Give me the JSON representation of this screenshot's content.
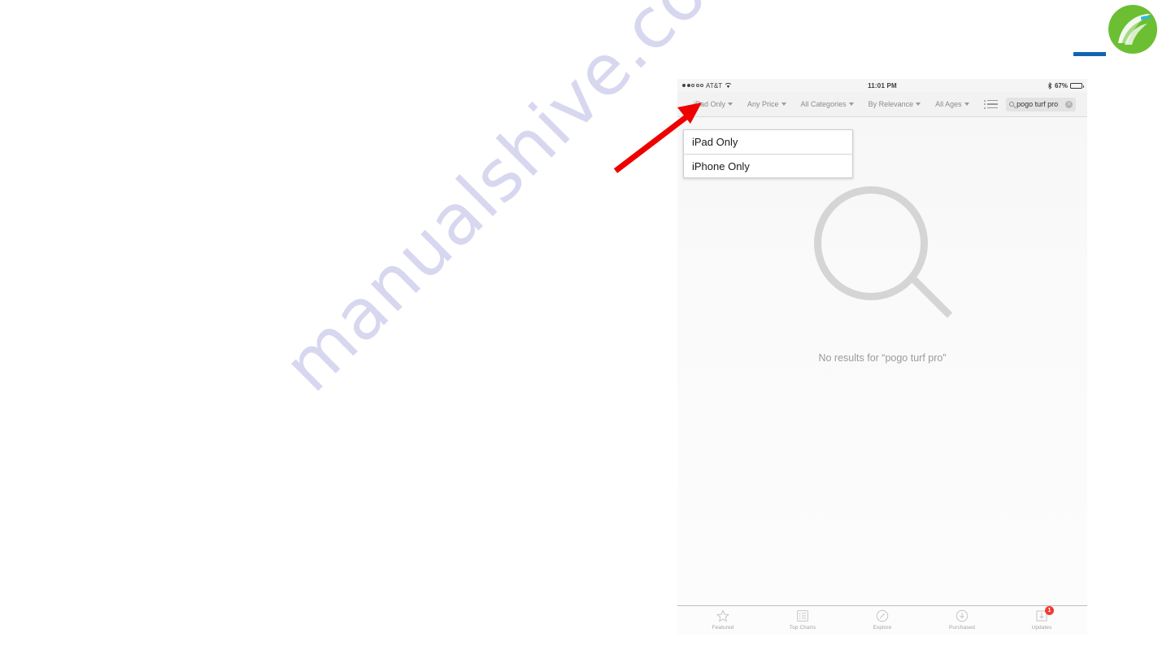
{
  "page": {
    "watermark": "manualshive.com",
    "brand_accent": "#6cbe33",
    "rule_color": "#1264b0"
  },
  "annotation": {
    "arrow_color": "#ee0000",
    "arrow_name": "red-callout-arrow",
    "points_to": "iPad Only"
  },
  "device": {
    "status_bar": {
      "signal_dots_filled": 2,
      "signal_dots_total": 5,
      "carrier": "AT&T",
      "wifi": "wifi-icon",
      "time": "11:01 PM",
      "bluetooth": "bluetooth-icon",
      "battery_percent": "67%",
      "battery_level": 67
    },
    "filter_bar": {
      "filters": [
        {
          "label": "iPad Only",
          "name": "device-filter"
        },
        {
          "label": "Any Price",
          "name": "price-filter"
        },
        {
          "label": "All Categories",
          "name": "category-filter"
        },
        {
          "label": "By Relevance",
          "name": "sort-filter"
        },
        {
          "label": "All Ages",
          "name": "age-filter"
        }
      ],
      "list_toggle_icon": "list-view-icon",
      "search": {
        "icon": "search-icon",
        "value": "pogo turf pro",
        "placeholder": "Search",
        "clear_glyph": "✕"
      }
    },
    "dropdown": {
      "open": true,
      "items": [
        {
          "label": "iPad Only"
        },
        {
          "label": "iPhone Only"
        }
      ]
    },
    "content": {
      "empty_icon": "magnifier-icon",
      "empty_message": "No results for “pogo turf pro”"
    },
    "tab_bar": {
      "tabs": [
        {
          "label": "Featured",
          "icon": "star-icon",
          "badge": ""
        },
        {
          "label": "Top Charts",
          "icon": "list-icon",
          "badge": ""
        },
        {
          "label": "Explore",
          "icon": "compass-icon",
          "badge": ""
        },
        {
          "label": "Purchased",
          "icon": "download-icon",
          "badge": ""
        },
        {
          "label": "Updates",
          "icon": "updates-icon",
          "badge": "1"
        }
      ]
    }
  }
}
